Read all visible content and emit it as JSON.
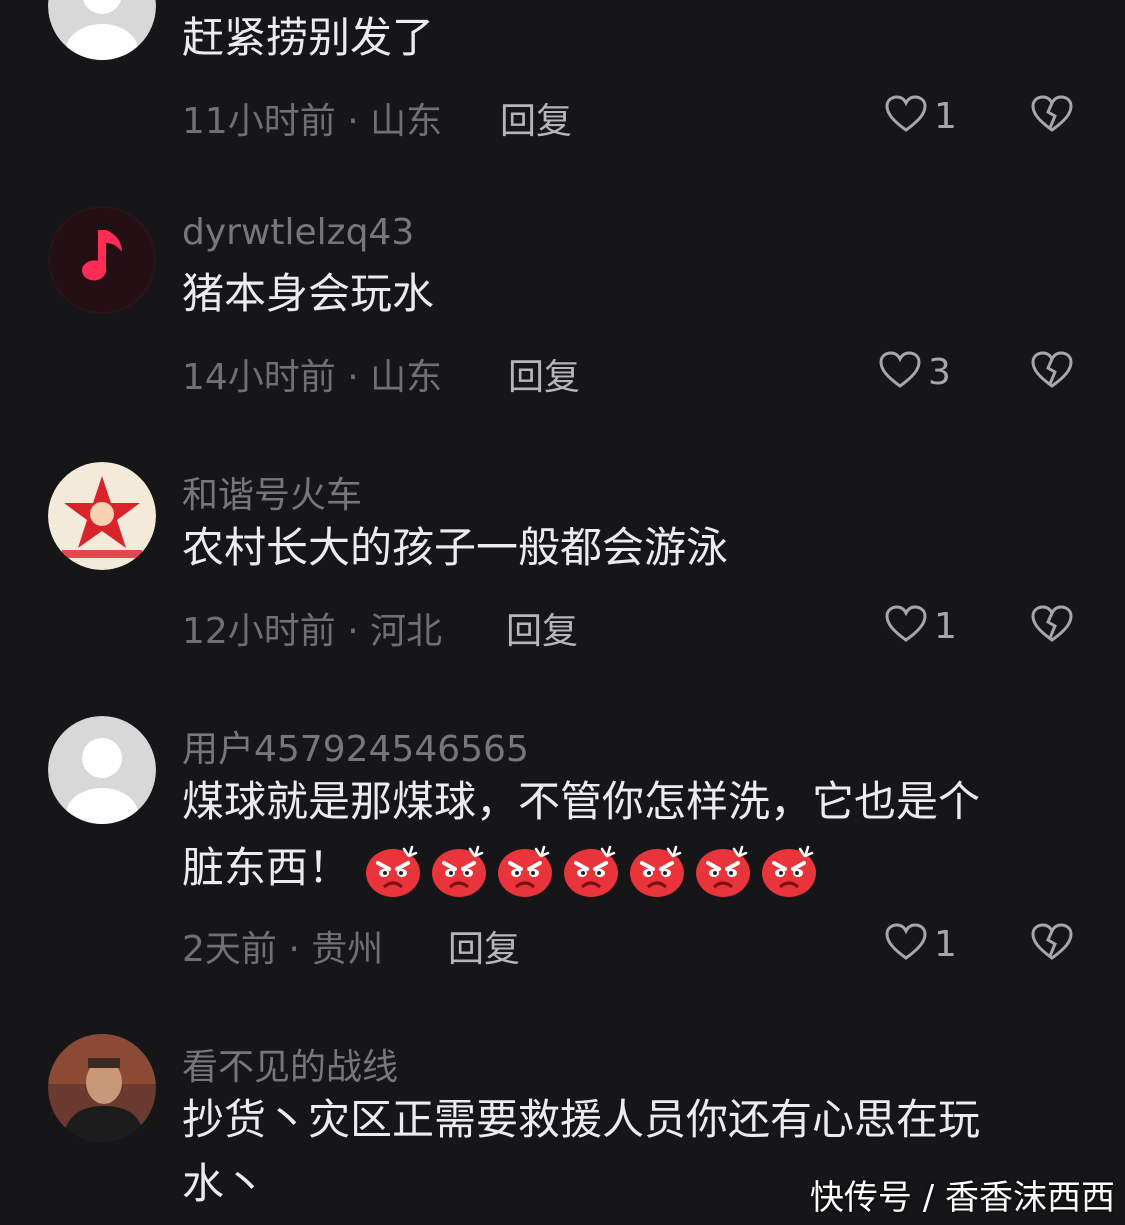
{
  "comments": [
    {
      "username": "",
      "text": "赶紧捞别发了",
      "time_location": "11小时前 · 山东",
      "reply_label": "回复",
      "likes": "1",
      "avatar": "default-avatar-icon"
    },
    {
      "username": "dyrwtlelzq43",
      "text": "猪本身会玩水",
      "time_location": "14小时前 · 山东",
      "reply_label": "回复",
      "likes": "3",
      "avatar": "music-note-icon"
    },
    {
      "username": "和谐号火车",
      "text": "农村长大的孩子一般都会游泳",
      "time_location": "12小时前 · 河北",
      "reply_label": "回复",
      "likes": "1",
      "avatar": "red-star-emblem-icon"
    },
    {
      "username": "用户457924546565",
      "text_line1": "煤球就是那煤球，不管你怎样洗，它也是个",
      "text_line2": "脏东西！",
      "emoji_count": 7,
      "emoji": "angry-face-icon",
      "time_location": "2天前 · 贵州",
      "reply_label": "回复",
      "likes": "1",
      "avatar": "default-avatar-icon"
    },
    {
      "username": "看不见的战线",
      "text_line1": "抄货丶灾区正需要救援人员你还有心思在玩",
      "text_line2": "水丶",
      "avatar": "user-photo-avatar"
    }
  ],
  "watermark": "快传号 / 香香沫西西",
  "colors": {
    "background": "#161618",
    "music_icon": "#ff2d55",
    "angry_emoji": "#e8343a"
  }
}
